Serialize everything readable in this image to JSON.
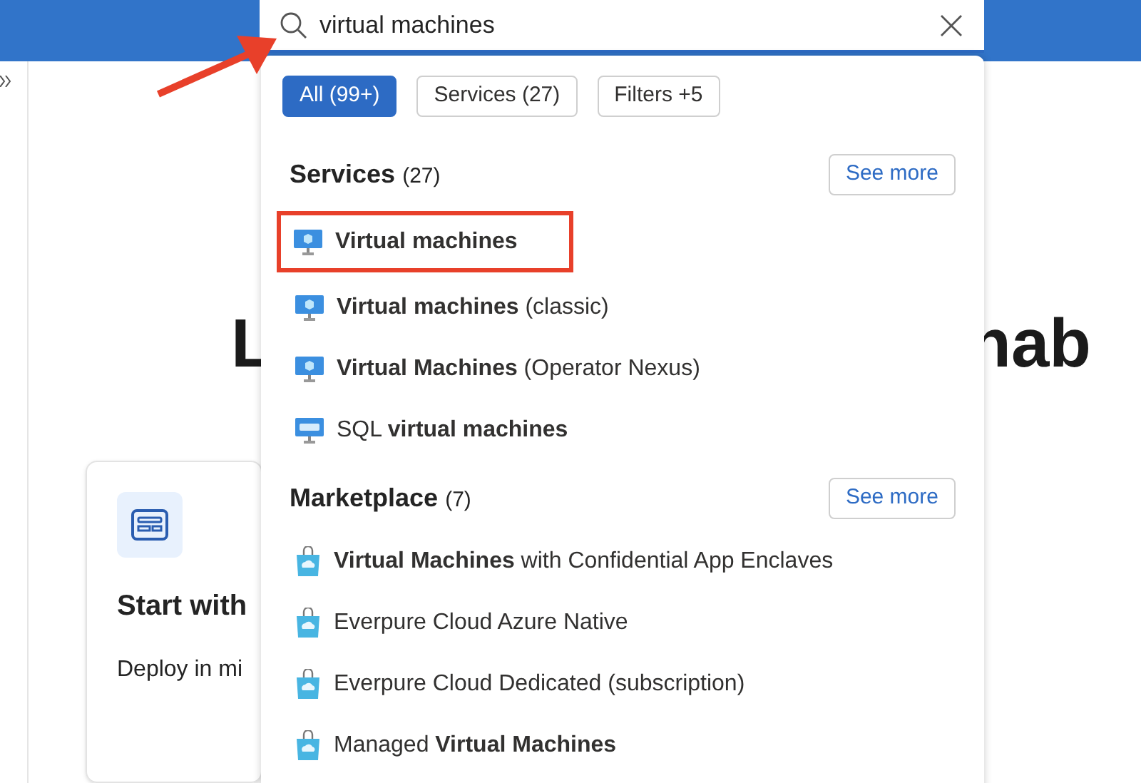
{
  "search": {
    "value": "virtual machines"
  },
  "filters": [
    {
      "label": "All (99+)",
      "selected": true
    },
    {
      "label": "Services (27)",
      "selected": false
    },
    {
      "label": "Filters +5",
      "selected": false
    }
  ],
  "sections": [
    {
      "title": "Services",
      "count": "(27)",
      "button": "See more",
      "items": [
        {
          "kind": "vm",
          "text": "**Virtual machines**",
          "highlighted": true
        },
        {
          "kind": "vm",
          "text": "**Virtual machines** (classic)",
          "highlighted": false
        },
        {
          "kind": "vm",
          "text": "**Virtual Machines** (Operator Nexus)",
          "highlighted": false
        },
        {
          "kind": "sql",
          "text": "SQL **virtual machines**",
          "highlighted": false
        }
      ]
    },
    {
      "title": "Marketplace",
      "count": "(7)",
      "button": "See more",
      "items": [
        {
          "kind": "marketplace",
          "text": "**Virtual Machines** with Confidential App Enclaves",
          "highlighted": false
        },
        {
          "kind": "marketplace",
          "text": "Everpure Cloud Azure Native",
          "highlighted": false
        },
        {
          "kind": "marketplace",
          "text": "Everpure Cloud Dedicated (subscription)",
          "highlighted": false
        },
        {
          "kind": "marketplace",
          "text": "Managed **Virtual Machines**",
          "highlighted": false
        }
      ]
    }
  ],
  "page": {
    "heading_left": "L",
    "heading_right": "nab",
    "card": {
      "title": "Start with",
      "text": "Deploy in mi"
    }
  }
}
